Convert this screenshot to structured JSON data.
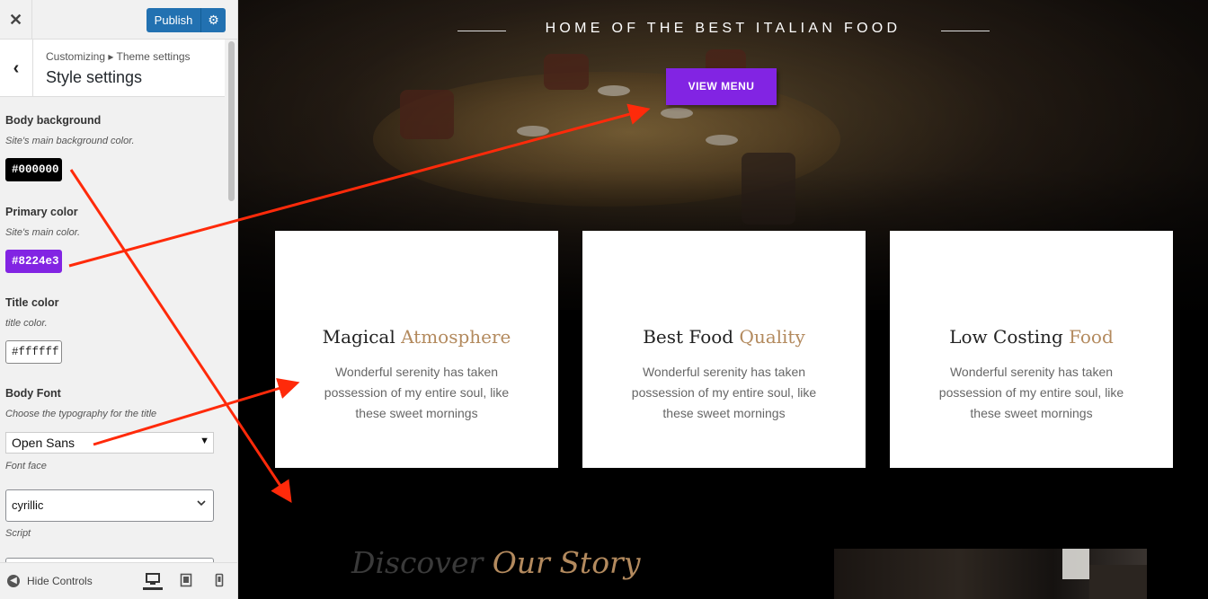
{
  "topbar": {
    "close_glyph": "✕",
    "publish_label": "Publish",
    "gear_glyph": "⚙"
  },
  "section": {
    "back_glyph": "‹",
    "breadcrumb": "Customizing ▸ Theme settings",
    "title": "Style settings"
  },
  "controls": {
    "body_background": {
      "label": "Body background",
      "description": "Site's main background color.",
      "value": "#000000",
      "color": "#000000"
    },
    "primary_color": {
      "label": "Primary color",
      "description": "Site's main color.",
      "value": "#8224e3",
      "color": "#8224e3"
    },
    "title_color": {
      "label": "Title color",
      "description": "title color.",
      "value": "#ffffff",
      "color": "#ffffff"
    },
    "body_font": {
      "label": "Body Font",
      "description": "Choose the typography for the title",
      "value": "Open Sans",
      "sublabel": "Font face"
    },
    "script": {
      "value": "cyrillic",
      "sublabel": "Script"
    }
  },
  "footer": {
    "hide_controls_label": "Hide Controls",
    "devices": [
      "desktop-icon",
      "tablet-icon",
      "mobile-icon"
    ],
    "active_device": "desktop"
  },
  "preview": {
    "hero_title": "HOME OF THE BEST ITALIAN FOOD",
    "view_menu_label": "VIEW MENU",
    "cards": [
      {
        "title_plain": "Magical",
        "title_accent": "Atmosphere",
        "text": "Wonderful serenity has taken possession of my entire soul, like these sweet mornings"
      },
      {
        "title_plain": "Best Food",
        "title_accent": "Quality",
        "text": "Wonderful serenity has taken possession of my entire soul, like these sweet mornings"
      },
      {
        "title_plain": "Low Costing",
        "title_accent": "Food",
        "text": "Wonderful serenity has taken possession of my entire soul, like these sweet mornings"
      }
    ],
    "story_plain": "Discover",
    "story_accent": "Our Story"
  },
  "colors": {
    "accent": "#8224e3",
    "publish": "#2271b1",
    "heading_accent": "#b38a5e",
    "annotation_arrow": "#ff2a0a"
  }
}
